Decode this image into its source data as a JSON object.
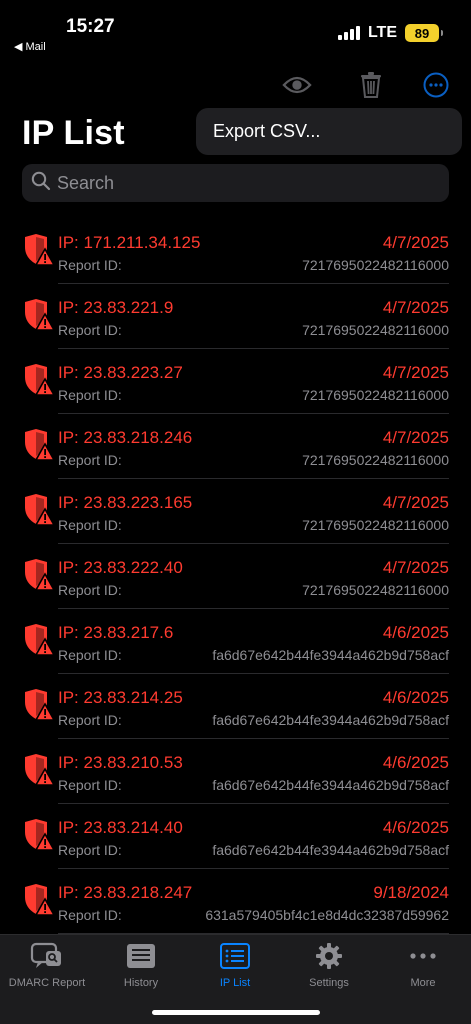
{
  "status": {
    "time": "15:27",
    "back_label": "◀ Mail",
    "network": "LTE",
    "battery": "89"
  },
  "toolbar": {
    "eye_icon": "eye-icon",
    "trash_icon": "trash-icon",
    "more_icon": "ellipsis-circle-icon"
  },
  "popup": {
    "export_label": "Export CSV..."
  },
  "page": {
    "title": "IP List"
  },
  "search": {
    "placeholder": "Search"
  },
  "rows": [
    {
      "ip": "IP: 171.211.34.125",
      "date": "4/7/2025",
      "report_label": "Report ID:",
      "report_id": "7217695022482116000"
    },
    {
      "ip": "IP: 23.83.221.9",
      "date": "4/7/2025",
      "report_label": "Report ID:",
      "report_id": "7217695022482116000"
    },
    {
      "ip": "IP: 23.83.223.27",
      "date": "4/7/2025",
      "report_label": "Report ID:",
      "report_id": "7217695022482116000"
    },
    {
      "ip": "IP: 23.83.218.246",
      "date": "4/7/2025",
      "report_label": "Report ID:",
      "report_id": "7217695022482116000"
    },
    {
      "ip": "IP: 23.83.223.165",
      "date": "4/7/2025",
      "report_label": "Report ID:",
      "report_id": "7217695022482116000"
    },
    {
      "ip": "IP: 23.83.222.40",
      "date": "4/7/2025",
      "report_label": "Report ID:",
      "report_id": "7217695022482116000"
    },
    {
      "ip": "IP: 23.83.217.6",
      "date": "4/6/2025",
      "report_label": "Report ID:",
      "report_id": "fa6d67e642b44fe3944a462b9d758acf"
    },
    {
      "ip": "IP: 23.83.214.25",
      "date": "4/6/2025",
      "report_label": "Report ID:",
      "report_id": "fa6d67e642b44fe3944a462b9d758acf"
    },
    {
      "ip": "IP: 23.83.210.53",
      "date": "4/6/2025",
      "report_label": "Report ID:",
      "report_id": "fa6d67e642b44fe3944a462b9d758acf"
    },
    {
      "ip": "IP: 23.83.214.40",
      "date": "4/6/2025",
      "report_label": "Report ID:",
      "report_id": "fa6d67e642b44fe3944a462b9d758acf"
    },
    {
      "ip": "IP: 23.83.218.247",
      "date": "9/18/2024",
      "report_label": "Report ID:",
      "report_id": "631a579405bf4c1e8d4dc32387d59962"
    }
  ],
  "tabs": [
    {
      "label": "DMARC Report",
      "icon": "report-icon"
    },
    {
      "label": "History",
      "icon": "history-icon"
    },
    {
      "label": "IP List",
      "icon": "ip-list-icon"
    },
    {
      "label": "Settings",
      "icon": "gear-icon"
    },
    {
      "label": "More",
      "icon": "more-icon"
    }
  ],
  "colors": {
    "alert_red": "#ff3b30",
    "accent_blue": "#0a84ff",
    "secondary_text": "#8e8e93"
  }
}
